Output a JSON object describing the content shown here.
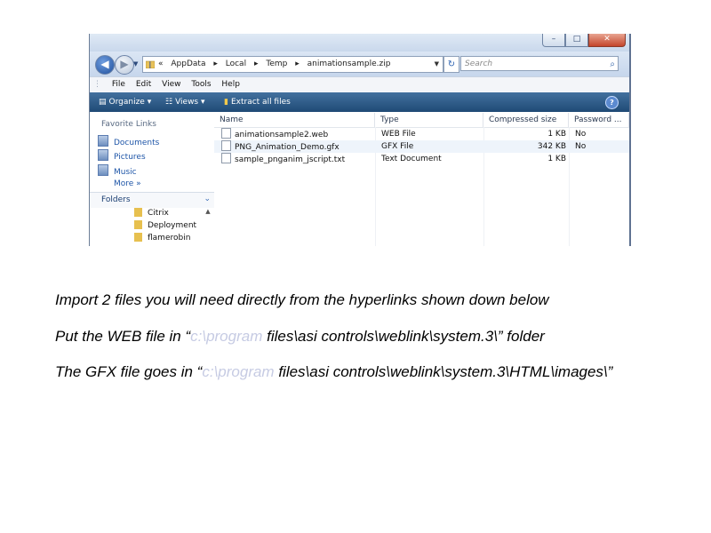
{
  "window": {
    "controls": {
      "minimize": "–",
      "maximize": "□",
      "close": "✕"
    },
    "address": {
      "crumbs": [
        "«",
        "AppData",
        "▸",
        "Local",
        "▸",
        "Temp",
        "▸",
        "animationsample.zip"
      ],
      "search_placeholder": "Search"
    },
    "menu": [
      "File",
      "Edit",
      "View",
      "Tools",
      "Help"
    ],
    "toolbar": {
      "organize": "Organize",
      "views": "Views",
      "extract": "Extract all files"
    },
    "nav": {
      "favorite_title": "Favorite Links",
      "links": [
        "Documents",
        "Pictures",
        "Music"
      ],
      "more": "More »",
      "folders_title": "Folders",
      "folders": [
        "Citrix",
        "Deployment",
        "flamerobin"
      ]
    },
    "columns": [
      "Name",
      "Type",
      "Compressed size",
      "Password ..."
    ],
    "files": [
      {
        "name": "animationsample2.web",
        "type": "WEB File",
        "size": "1 KB",
        "password": "No"
      },
      {
        "name": "PNG_Animation_Demo.gfx",
        "type": "GFX File",
        "size": "342 KB",
        "password": "No"
      },
      {
        "name": "sample_pnganim_jscript.txt",
        "type": "Text Document",
        "size": "1 KB",
        "password": ""
      }
    ]
  },
  "instructions": {
    "line1": "Import 2 files you will need directly from the hyperlinks shown down below",
    "line2_pre": "Put the WEB file in “",
    "line2_faint": "c:\\program",
    "line2_post": " files\\asi controls\\weblink\\system.3\\” folder",
    "line3_pre": "The GFX file goes in “",
    "line3_faint": "c:\\program",
    "line3_post": " files\\asi controls\\weblink\\system.3\\HTML\\images\\”"
  },
  "colors": {
    "toolbar": "#2c5a89",
    "link": "#1f56a8",
    "faint_text": "#c6cbe3"
  }
}
